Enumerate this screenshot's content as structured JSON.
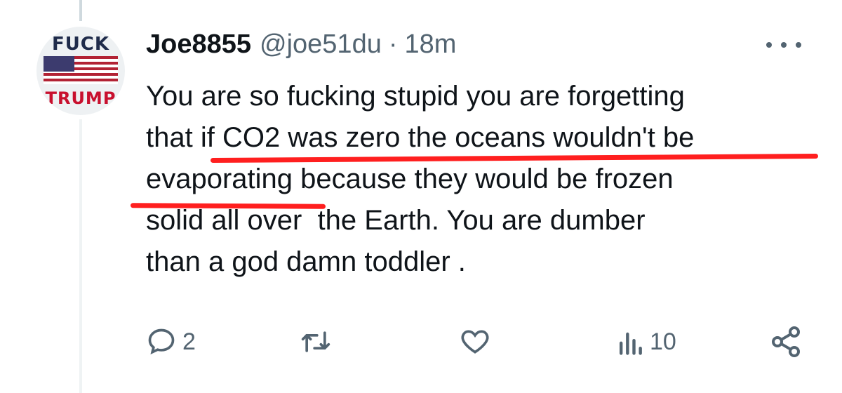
{
  "tweet": {
    "display_name": "Joe8855",
    "handle": "@joe51du",
    "separator": "·",
    "time": "18m",
    "text_lines": [
      "You are so fucking stupid you are forgetting",
      "that if CO2 was zero the oceans wouldn't be",
      "evaporating because they would be frozen",
      "solid all over  the Earth. You are dumber",
      "than a god damn toddler ."
    ]
  },
  "avatar": {
    "text_top": "FUCK",
    "text_bottom": "TRUMP",
    "flag_colors": {
      "blue": "#3c3b6e",
      "red": "#b22234",
      "white": "#ffffff"
    }
  },
  "actions": {
    "reply_count": "2",
    "retweet_count": "",
    "like_count": "",
    "views_count": "10"
  },
  "annotations": {
    "underline_color": "#ff1f1f"
  },
  "colors": {
    "text": "#0f1419",
    "secondary": "#536471"
  }
}
